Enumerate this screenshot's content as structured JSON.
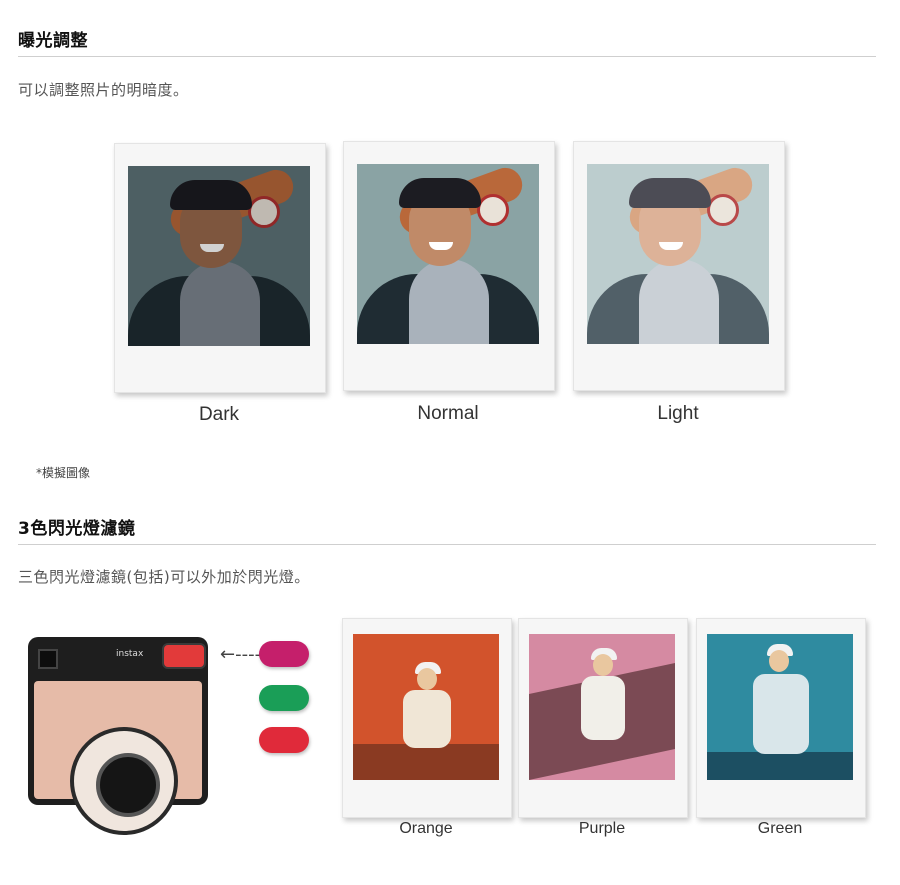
{
  "exposure": {
    "title": "曝光調整",
    "description": "可以調整照片的明暗度。",
    "photos": [
      {
        "label": "Dark",
        "tone": "#4b6168"
      },
      {
        "label": "Normal",
        "tone": "#7a8f92"
      },
      {
        "label": "Light",
        "tone": "#9fb1b4"
      }
    ],
    "note": "*模擬圖像"
  },
  "flash_filter": {
    "title": "3色閃光燈濾鏡",
    "description": "三色閃光燈濾鏡(包括)可以外加於閃光燈。",
    "camera_brand": "instax",
    "filters": [
      {
        "color": "#c51f6b"
      },
      {
        "color": "#1a9e57"
      },
      {
        "color": "#e02a3a"
      }
    ],
    "arrow": "←------",
    "photos": [
      {
        "label": "Orange",
        "bg": "#d2532c",
        "floor": "#8a3a22"
      },
      {
        "label": "Purple",
        "bg": "#d58aa2",
        "floor": "#7b4a54"
      },
      {
        "label": "Green",
        "bg": "#2f8ba0",
        "floor": "#1c4f62"
      }
    ]
  }
}
